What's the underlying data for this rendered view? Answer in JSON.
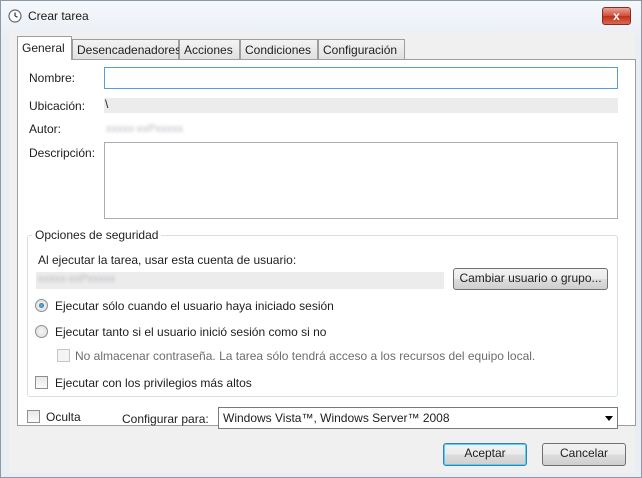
{
  "window": {
    "title": "Crear tarea",
    "close_glyph": "x"
  },
  "tabs": [
    {
      "label": "General",
      "active": true
    },
    {
      "label": "Desencadenadores",
      "active": false
    },
    {
      "label": "Acciones",
      "active": false
    },
    {
      "label": "Condiciones",
      "active": false
    },
    {
      "label": "Configuración",
      "active": false
    }
  ],
  "general": {
    "name_label": "Nombre:",
    "name_value": "",
    "location_label": "Ubicación:",
    "location_value": "\\",
    "author_label": "Autor:",
    "author_value": "xxxxx-xxPxxxxx",
    "description_label": "Descripción:",
    "description_value": ""
  },
  "security": {
    "group_title": "Opciones de seguridad",
    "account_prompt": "Al ejecutar la tarea, usar esta cuenta de usuario:",
    "account_value": "xxxxx-xxPxxxxx",
    "change_user_button": "Cambiar usuario o grupo...",
    "radio_logged_on": "Ejecutar sólo cuando el usuario haya iniciado sesión",
    "radio_logged_on_selected": true,
    "radio_any": "Ejecutar tanto si el usuario inició sesión como si no",
    "radio_any_selected": false,
    "no_store_password": "No almacenar contraseña. La tarea sólo tendrá acceso a los recursos del equipo local.",
    "no_store_password_enabled": false,
    "highest_privileges": "Ejecutar con los privilegios más altos",
    "highest_privileges_checked": false
  },
  "footer": {
    "hidden_label": "Oculta",
    "hidden_checked": false,
    "configure_label": "Configurar para:",
    "configure_value": "Windows Vista™, Windows Server™ 2008"
  },
  "buttons": {
    "ok": "Aceptar",
    "cancel": "Cancelar"
  },
  "icons": {
    "title": "clock-icon",
    "close": "close-icon",
    "dropdown": "chevron-down-icon"
  },
  "colors": {
    "focus_border": "#569de5",
    "close_button": "#c0301b",
    "default_button_border": "#3c7fb1"
  }
}
